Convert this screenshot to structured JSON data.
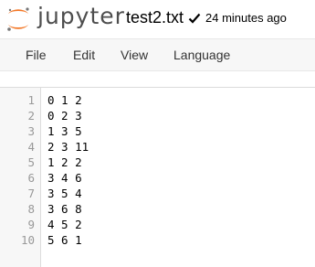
{
  "header": {
    "logo_text": "jupyter",
    "filename": "test2.txt",
    "saved_status": "24 minutes ago",
    "colors": {
      "logo_orange": "#f37726",
      "logo_gray": "#767677"
    }
  },
  "menu": [
    {
      "label": "File"
    },
    {
      "label": "Edit"
    },
    {
      "label": "View"
    },
    {
      "label": "Language"
    }
  ],
  "editor": {
    "lines": [
      {
        "num": "1",
        "text": "0 1 2"
      },
      {
        "num": "2",
        "text": "0 2 3"
      },
      {
        "num": "3",
        "text": "1 3 5"
      },
      {
        "num": "4",
        "text": "2 3 11"
      },
      {
        "num": "5",
        "text": "1 2 2"
      },
      {
        "num": "6",
        "text": "3 4 6"
      },
      {
        "num": "7",
        "text": "3 5 4"
      },
      {
        "num": "8",
        "text": "3 6 8"
      },
      {
        "num": "9",
        "text": "4 5 2"
      },
      {
        "num": "10",
        "text": "5 6 1"
      }
    ]
  }
}
